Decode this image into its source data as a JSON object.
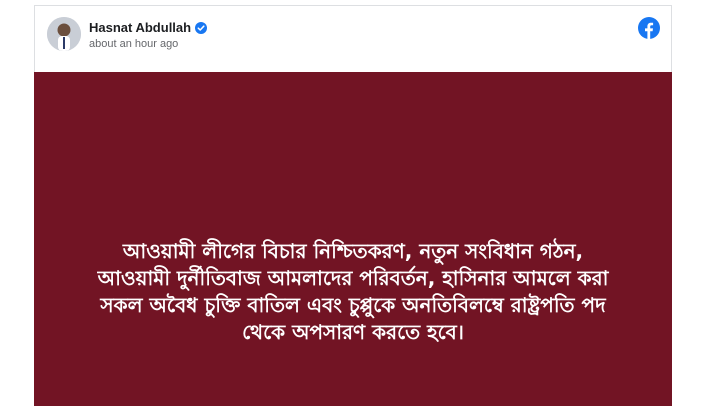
{
  "post": {
    "author_name": "Hasnat Abdullah",
    "timestamp": "about an hour ago",
    "verified": true,
    "avatar_icon": "user-avatar",
    "platform_icon": "facebook-logo-icon",
    "brand_color": "#1877f2",
    "image_background": "#721424",
    "image_text": "আওয়ামী লীগের বিচার নিশ্চিতকরণ, নতুন সংবিধান গঠন,\nআওয়ামী দুর্নীতিবাজ আমলাদের পরিবর্তন, হাসিনার আমলে করা\nসকল অবৈধ চুক্তি বাতিল এবং চুপ্পুকে অনতিবিলম্বে রাষ্ট্রপতি পদ\nথেকে অপসারণ করতে হবে।"
  }
}
